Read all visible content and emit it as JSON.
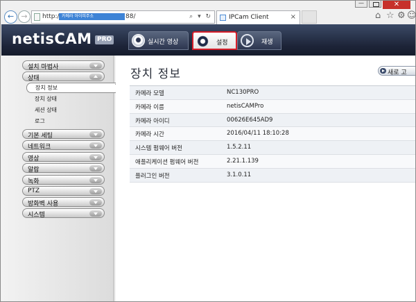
{
  "browser": {
    "minimize_label": "—",
    "close_label": "✕",
    "back_icon": "back-arrow-icon",
    "forward_icon": "forward-arrow-icon",
    "address_prefix": "http://",
    "address_masked": "카메라 아이피주소",
    "address_suffix": "88/",
    "address_actions": "⌕ ▾ ↻",
    "tab_title": "IPCam Client",
    "tab_close": "×",
    "toolbar_icons": [
      "home-icon",
      "star-icon",
      "gear-icon",
      "smiley-icon"
    ]
  },
  "header": {
    "brand": "netisCAM",
    "brand_badge": "PRO",
    "nav": [
      {
        "label": "실시간 영상",
        "icon": "camera-icon"
      },
      {
        "label": "설정",
        "icon": "gear-icon"
      },
      {
        "label": "재생",
        "icon": "play-icon"
      }
    ]
  },
  "sidebar": {
    "items": [
      {
        "label": "설치 마법사",
        "open": false
      },
      {
        "label": "상태",
        "open": true
      },
      {
        "label": "기본 세팅",
        "open": false
      },
      {
        "label": "네트워크",
        "open": false
      },
      {
        "label": "영상",
        "open": false
      },
      {
        "label": "알람",
        "open": false
      },
      {
        "label": "녹화",
        "open": false
      },
      {
        "label": "PTZ",
        "open": false
      },
      {
        "label": "방화벽 사용",
        "open": false
      },
      {
        "label": "시스템",
        "open": false
      }
    ],
    "status_children": [
      {
        "label": "장치 정보",
        "active": true
      },
      {
        "label": "장치 상태",
        "active": false
      },
      {
        "label": "세션 상태",
        "active": false
      },
      {
        "label": "로그",
        "active": false
      }
    ]
  },
  "content": {
    "title": "장치 정보",
    "refresh_label": "새로 고",
    "rows": [
      {
        "label": "카메라 모델",
        "value": "NC130PRO"
      },
      {
        "label": "카메라 이름",
        "value": "netisCAMPro"
      },
      {
        "label": "카메라 아이디",
        "value": "00626E645AD9"
      },
      {
        "label": "카메라 시간",
        "value": "2016/04/11 18:10:28"
      },
      {
        "label": "시스템 펌웨어 버전",
        "value": "1.5.2.11"
      },
      {
        "label": "애플리케이션 펌웨어 버전",
        "value": "2.21.1.139"
      },
      {
        "label": "플러그인 버전",
        "value": "3.1.0.11"
      }
    ]
  },
  "colors": {
    "header_dark": "#1d2438",
    "selected_border": "#d61e2a",
    "window_close": "#c7302b"
  }
}
